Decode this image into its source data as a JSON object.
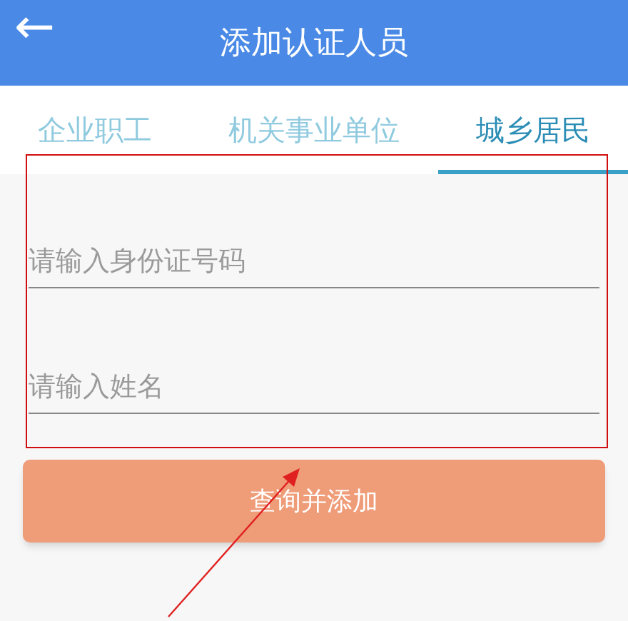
{
  "header": {
    "back": "←",
    "title": "添加认证人员"
  },
  "tabs": [
    {
      "label": "企业职工",
      "selected": false
    },
    {
      "label": "机关事业单位",
      "selected": false
    },
    {
      "label": "城乡居民",
      "selected": true
    }
  ],
  "fields": [
    {
      "placeholder": "请输入身份证号码"
    },
    {
      "placeholder": "请输入姓名"
    }
  ],
  "submit_button": "查询并添加"
}
